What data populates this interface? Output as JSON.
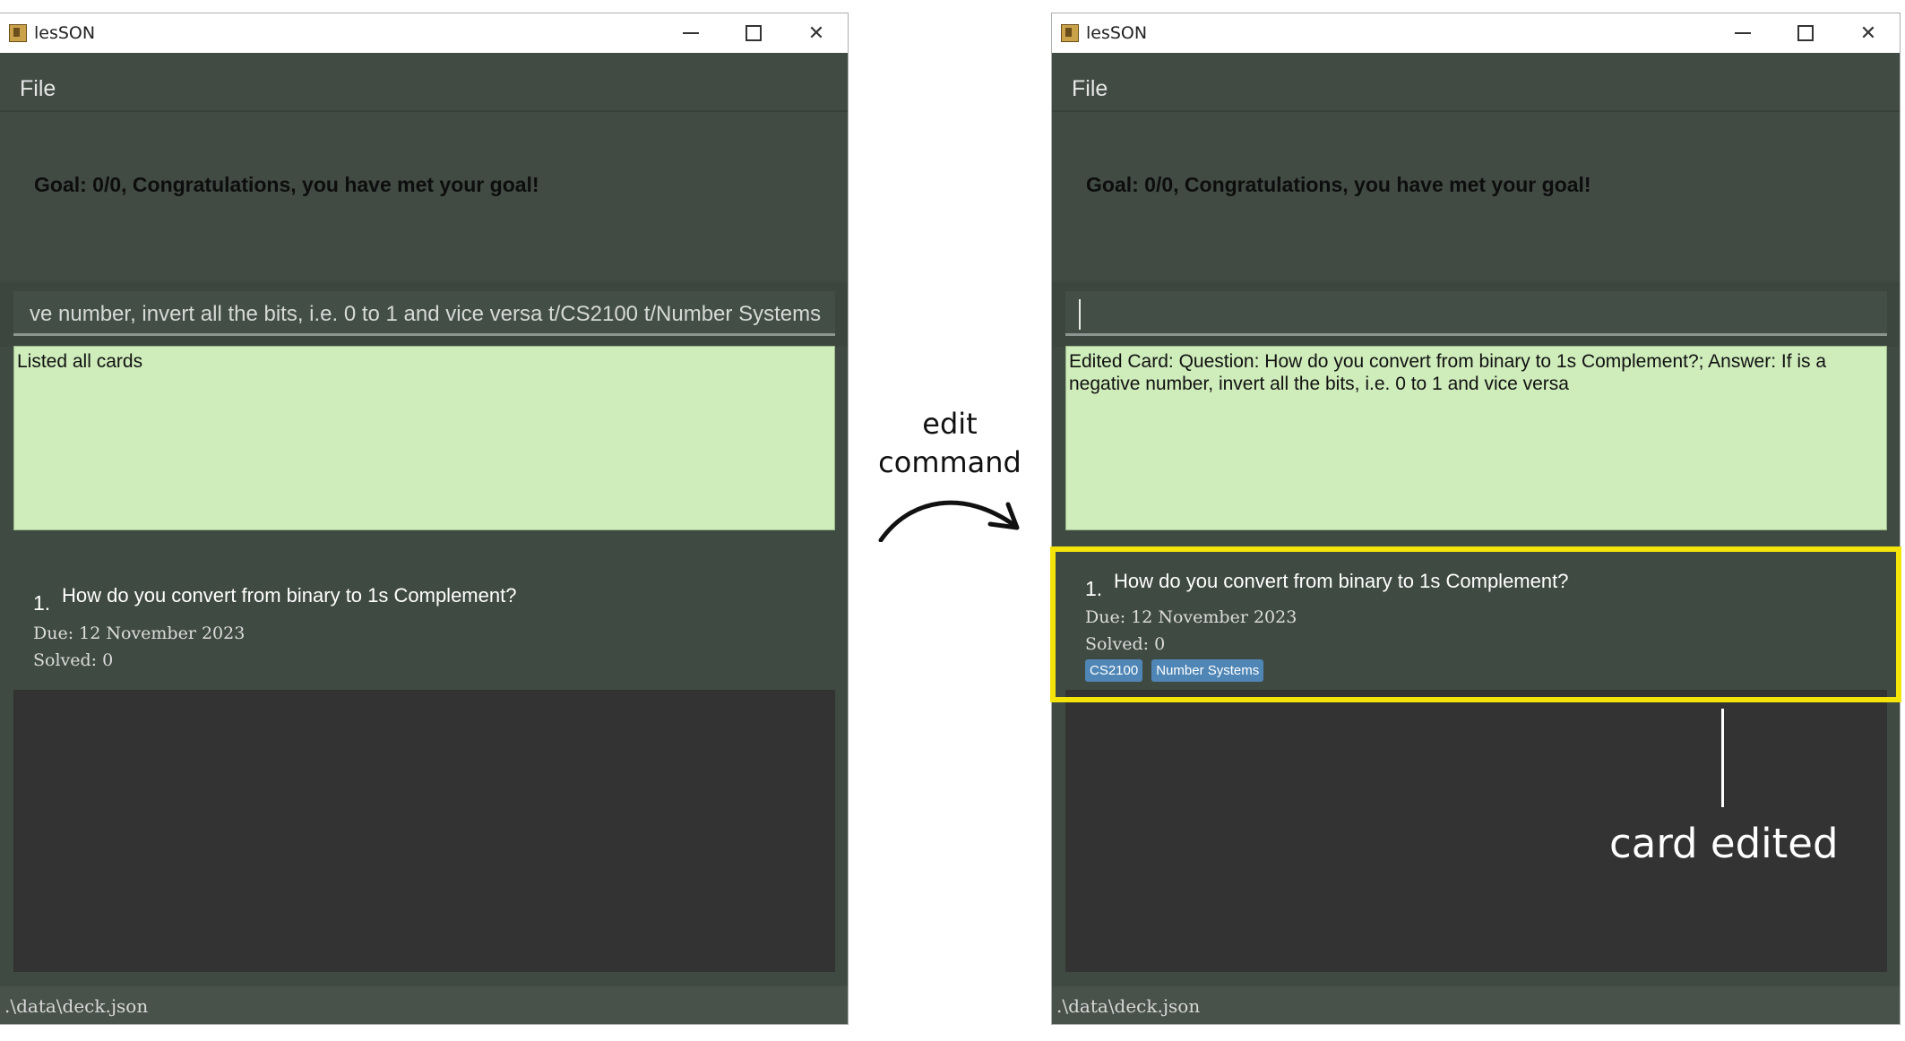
{
  "app": {
    "title": "lesSON",
    "menu_file": "File"
  },
  "left": {
    "goal": "Goal: 0/0, Congratulations, you have met your goal!",
    "command_text": "ve number, invert all the bits, i.e. 0 to 1 and vice versa t/CS2100 t/Number Systems",
    "result": "Listed all cards",
    "card": {
      "index": "1.",
      "question": "How do you convert from binary to 1s Complement?",
      "due": "Due: 12 November 2023",
      "solved": "Solved: 0"
    },
    "status": ".\\data\\deck.json"
  },
  "right": {
    "goal": "Goal: 0/0, Congratulations, you have met your goal!",
    "command_text": "",
    "result": "Edited Card: Question: How do you convert from binary to 1s Complement?; Answer: If is a negative number, invert all the bits, i.e. 0 to 1 and vice versa",
    "card": {
      "index": "1.",
      "question": "How do you convert from binary to 1s Complement?",
      "due": "Due: 12 November 2023",
      "solved": "Solved: 0",
      "tags": [
        "CS2100",
        "Number Systems"
      ]
    },
    "status": ".\\data\\deck.json"
  },
  "annotations": {
    "arrow_label_line1": "edit",
    "arrow_label_line2": "command",
    "card_edited": "card edited",
    "highlight_color": "#f4e40a"
  },
  "colors": {
    "window_bg": "#3f4a42",
    "result_bg": "#cfecbb",
    "tag_bg": "#4f86b6",
    "list_bg": "#333333"
  }
}
